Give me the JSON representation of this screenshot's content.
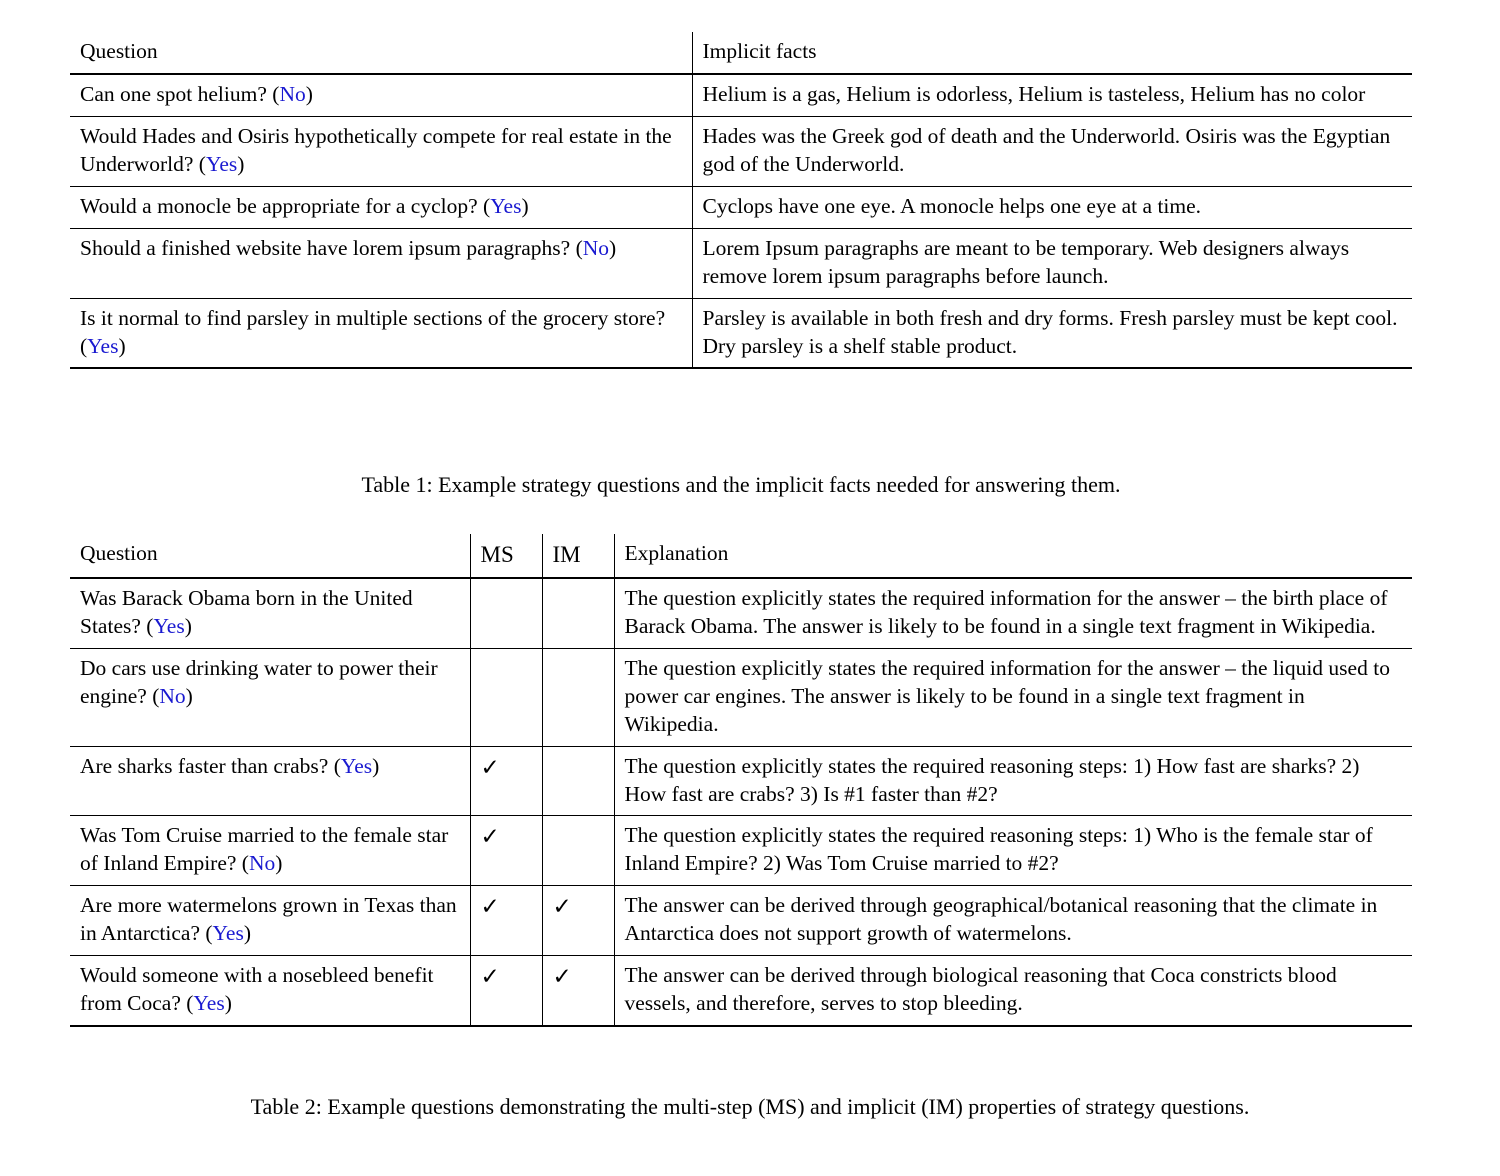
{
  "table1": {
    "headers": [
      "Question",
      "Implicit facts"
    ],
    "rows": [
      {
        "question_text": "Can one spot helium? (",
        "answer": "No",
        "question_tail": ")",
        "facts": "Helium is a gas, Helium is odorless, Helium is tasteless, Helium has no color"
      },
      {
        "question_text": "Would Hades and Osiris hypothetically compete for real estate in the Underworld? (",
        "answer": "Yes",
        "question_tail": ")",
        "facts": "Hades was the Greek god of death and the Underworld. Osiris was the Egyptian god of the Underworld."
      },
      {
        "question_text": "Would a monocle be appropriate for a cyclop? (",
        "answer": "Yes",
        "question_tail": ")",
        "facts": "Cyclops have one eye. A monocle helps one eye at a time."
      },
      {
        "question_text": "Should a finished website have lorem ipsum paragraphs? (",
        "answer": "No",
        "question_tail": ")",
        "facts": "Lorem Ipsum paragraphs are meant to be temporary. Web designers always remove lorem ipsum paragraphs before launch."
      },
      {
        "question_text": "Is it normal to find parsley in multiple sections of the grocery store? (",
        "answer": "Yes",
        "question_tail": ")",
        "facts": "Parsley is available in both fresh and dry forms. Fresh parsley must be kept cool. Dry parsley is a shelf stable product."
      }
    ],
    "caption": "Table 1: Example strategy questions and the implicit facts needed for answering them."
  },
  "table2": {
    "headers": [
      "Question",
      "MS",
      "IM",
      "Explanation"
    ],
    "check_glyph": "✓",
    "rows": [
      {
        "question_text": "Was Barack Obama born in the United States? (",
        "answer": "Yes",
        "question_tail": ")",
        "ms": "",
        "im": "",
        "explanation": "The question explicitly states the required information for the answer – the birth place of Barack Obama. The answer is likely to be found in a single text fragment in Wikipedia."
      },
      {
        "question_text": "Do cars use drinking water to power their engine? (",
        "answer": "No",
        "question_tail": ")",
        "ms": "",
        "im": "",
        "explanation": "The question explicitly states the required information for the answer – the liquid used to power car engines. The answer is likely to be found in a single text fragment in Wikipedia."
      },
      {
        "question_text": "Are sharks faster than crabs? (",
        "answer": "Yes",
        "question_tail": ")",
        "ms": "✓",
        "im": "",
        "explanation": "The question explicitly states the required reasoning steps: 1) How fast are sharks? 2) How fast are crabs? 3) Is #1 faster than #2?"
      },
      {
        "question_text": "Was Tom Cruise married to the female star of Inland Empire? (",
        "answer": "No",
        "question_tail": ")",
        "ms": "✓",
        "im": "",
        "explanation": "The question explicitly states the required reasoning steps: 1) Who is the female star of Inland Empire? 2) Was Tom Cruise married to #2?"
      },
      {
        "question_text": "Are more watermelons grown in Texas than in Antarctica? (",
        "answer": "Yes",
        "question_tail": ")",
        "ms": "✓",
        "im": "✓",
        "explanation": "The answer can be derived through geographical/botanical reasoning that the climate in Antarctica does not support growth of watermelons."
      },
      {
        "question_text": "Would someone with a nosebleed benefit from Coca? (",
        "answer": "Yes",
        "question_tail": ")",
        "ms": "✓",
        "im": "✓",
        "explanation": "The answer can be derived through biological reasoning that Coca constricts blood vessels, and therefore, serves to stop bleeding."
      }
    ],
    "caption": "Table 2: Example questions demonstrating the multi-step (MS) and implicit (IM) properties of strategy questions."
  },
  "colors": {
    "answer_blue": "#1919d0",
    "rule_black": "#000000",
    "page_background": "#ffffff"
  }
}
